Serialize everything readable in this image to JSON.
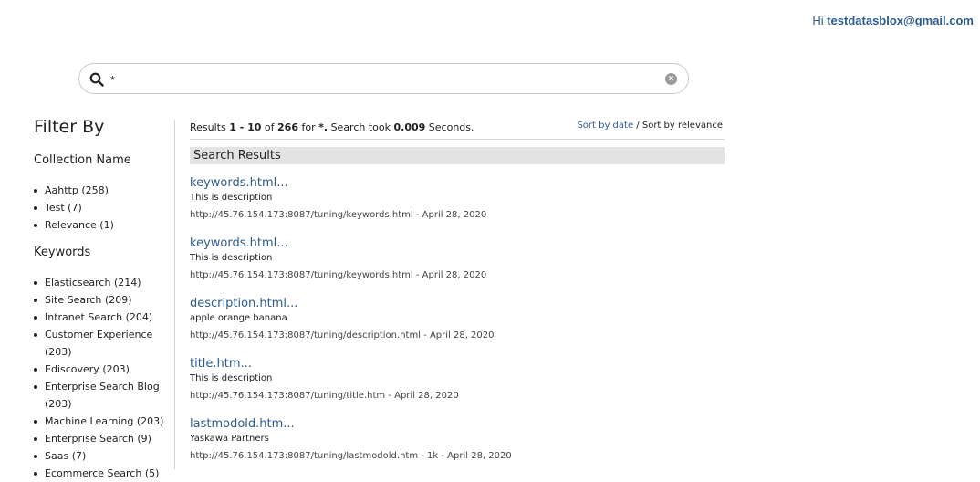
{
  "header": {
    "greeting_prefix": "Hi",
    "user_email": "testdatasblox@gmail.com"
  },
  "search": {
    "query": "*",
    "icon": "search-icon",
    "clear_icon": "clear-icon"
  },
  "filter": {
    "title": "Filter By",
    "groups": [
      {
        "name": "Collection Name",
        "items": [
          {
            "label": "Aahttp",
            "count": "(258)"
          },
          {
            "label": "Test",
            "count": "(7)"
          },
          {
            "label": "Relevance",
            "count": "(1)"
          }
        ]
      },
      {
        "name": "Keywords",
        "items": [
          {
            "label": "Elasticsearch",
            "count": "(214)"
          },
          {
            "label": "Site Search",
            "count": "(209)"
          },
          {
            "label": "Intranet Search",
            "count": "(204)"
          },
          {
            "label": "Customer Experience",
            "count": "(203)"
          },
          {
            "label": "Ediscovery",
            "count": "(203)"
          },
          {
            "label": "Enterprise Search Blog",
            "count": "(203)"
          },
          {
            "label": "Machine Learning",
            "count": "(203)"
          },
          {
            "label": "Enterprise Search",
            "count": "(9)"
          },
          {
            "label": "Saas",
            "count": "(7)"
          },
          {
            "label": "Ecommerce Search",
            "count": "(5)"
          }
        ]
      }
    ]
  },
  "summary": {
    "prefix": "Results",
    "range": "1 - 10",
    "of": "of",
    "total": "266",
    "for": "for",
    "query": "*.",
    "took": "Search took",
    "time": "0.009",
    "unit": "Seconds."
  },
  "sort": {
    "by_date": "Sort by date",
    "separator": "/",
    "by_relevance": "Sort by relevance"
  },
  "results_header": "Search Results",
  "results": [
    {
      "title": "keywords.html...",
      "description": "This is description",
      "url": "http://45.76.154.173:8087/tuning/keywords.html",
      "meta": "- April 28, 2020"
    },
    {
      "title": "keywords.html...",
      "description": "This is description",
      "url": "http://45.76.154.173:8087/tuning/keywords.html",
      "meta": "- April 28, 2020"
    },
    {
      "title": "description.html...",
      "description": "apple orange banana",
      "url": "http://45.76.154.173:8087/tuning/description.html",
      "meta": "- April 28, 2020"
    },
    {
      "title": "title.htm...",
      "description": "This is description",
      "url": "http://45.76.154.173:8087/tuning/title.htm",
      "meta": "- April 28, 2020"
    },
    {
      "title": "lastmodold.htm...",
      "description": "Yaskawa Partners",
      "url": "http://45.76.154.173:8087/tuning/lastmodold.htm",
      "meta": "- 1k - April 28, 2020"
    }
  ],
  "colors": {
    "link": "#2c5d8f",
    "header_bg": "#e3e3e3"
  }
}
